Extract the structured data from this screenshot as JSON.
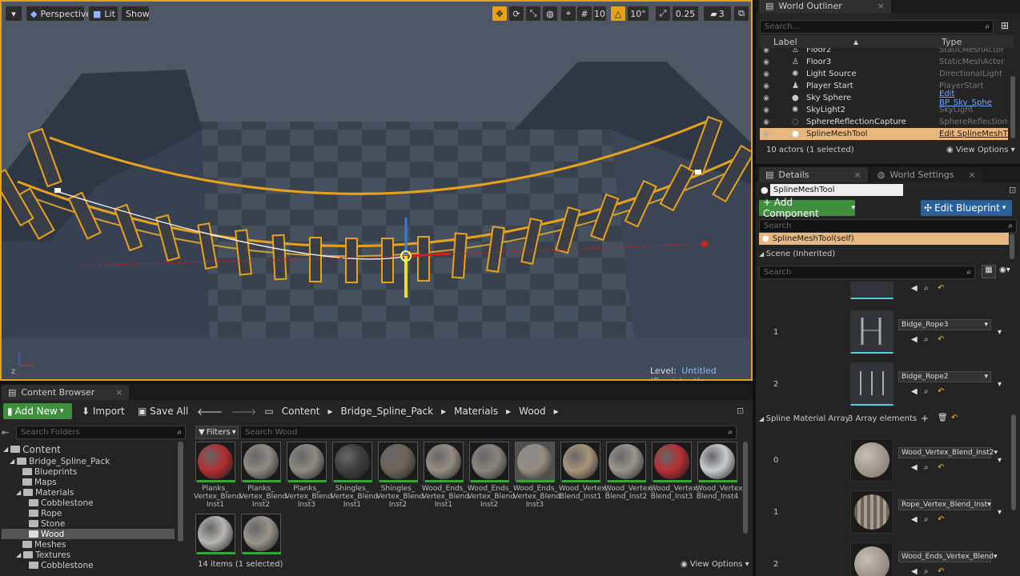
{
  "viewport": {
    "perspective_label": "Perspective",
    "lit_label": "Lit",
    "show_label": "Show",
    "grid_snap": "10",
    "angle_snap": "10°",
    "scale_snap": "0.25",
    "camera_speed": "3",
    "level_prefix": "Level:",
    "level_name": "Untitled (Persistent)",
    "accent": "#e8a21a"
  },
  "outliner": {
    "tab_title": "World Outliner",
    "search_placeholder": "Search...",
    "col_label": "Label",
    "col_type": "Type",
    "rows": [
      {
        "label": "Floor2",
        "type": "StaticMeshActor"
      },
      {
        "label": "Floor3",
        "type": "StaticMeshActor"
      },
      {
        "label": "Light Source",
        "type": "DirectionalLight"
      },
      {
        "label": "Player Start",
        "type": "PlayerStart"
      },
      {
        "label": "Sky Sphere",
        "type": "Edit BP_Sky_Sphe"
      },
      {
        "label": "SkyLight2",
        "type": "SkyLight"
      },
      {
        "label": "SphereReflectionCapture",
        "type": "SphereReflectionC"
      },
      {
        "label": "SplineMeshTool",
        "type": "Edit SplineMeshT"
      }
    ],
    "actor_count": "10 actors (1 selected)",
    "view_options": "View Options"
  },
  "details": {
    "tab_details": "Details",
    "tab_world_settings": "World Settings",
    "name_value": "SplineMeshTool",
    "add_component": "+ Add Component",
    "edit_blueprint": "Edit Blueprint",
    "search_placeholder": "Search",
    "self_item": "SplineMeshTool(self)",
    "scene_item": "Scene (Inherited)",
    "search2_placeholder": "Search",
    "mesh_rows": [
      {
        "index": "1",
        "name": "Bidge_Rope3"
      },
      {
        "index": "2",
        "name": "Bidge_Rope2"
      }
    ],
    "spline_material_label": "Spline Material Array",
    "spline_material_count": "3 Array elements",
    "material_rows": [
      {
        "index": "0",
        "name": "Wood_Vertex_Blend_Inst2"
      },
      {
        "index": "1",
        "name": "Rope_Vertex_Blend_Inst"
      },
      {
        "index": "2",
        "name": "Wood_Ends_Vertex_Blend"
      }
    ]
  },
  "content_browser": {
    "tab_title": "Content Browser",
    "add_new": "Add New",
    "import": "Import",
    "save_all": "Save All",
    "breadcrumb": [
      "Content",
      "Bridge_Spline_Pack",
      "Materials",
      "Wood"
    ],
    "search_folders_placeholder": "Search Folders",
    "filters_label": "Filters",
    "search_wood_placeholder": "Search Wood",
    "tree": [
      {
        "label": "Content",
        "level": 0
      },
      {
        "label": "Bridge_Spline_Pack",
        "level": 1
      },
      {
        "label": "Blueprints",
        "level": 2
      },
      {
        "label": "Maps",
        "level": 2
      },
      {
        "label": "Materials",
        "level": 2
      },
      {
        "label": "Cobblestone",
        "level": 3
      },
      {
        "label": "Rope",
        "level": 3
      },
      {
        "label": "Stone",
        "level": 3
      },
      {
        "label": "Wood",
        "level": 3
      },
      {
        "label": "Meshes",
        "level": 2
      },
      {
        "label": "Textures",
        "level": 2
      },
      {
        "label": "Cobblestone",
        "level": 3
      }
    ],
    "assets": [
      {
        "label": "Planks_ Vertex_Blend Inst1",
        "color": "#b13033"
      },
      {
        "label": "Planks_ Vertex_Blend Inst2",
        "color": "#8f8a82"
      },
      {
        "label": "Planks_ Vertex_Blend Inst3",
        "color": "#8e8a83"
      },
      {
        "label": "Shingles_ Vertex_Blend Inst1",
        "color": "#3c3f3c"
      },
      {
        "label": "Shingles_ Vertex_Blend Inst2",
        "color": "#6b6457"
      },
      {
        "label": "Wood_Ends_ Vertex_Blend Inst1",
        "color": "#948d82"
      },
      {
        "label": "Wood_Ends_ Vertex_Blend Inst2",
        "color": "#8a857c"
      },
      {
        "label": "Wood_Ends_ Vertex_Blend Inst3",
        "color": "#938c80"
      },
      {
        "label": "Wood_Vertex_ Blend_Inst1",
        "color": "#a8957a"
      },
      {
        "label": "Wood_Vertex_ Blend_Inst2",
        "color": "#9a948c"
      },
      {
        "label": "Wood_Vertex_ Blend_Inst3",
        "color": "#b53034"
      },
      {
        "label": "Wood_Vertex_ Blend_Inst4",
        "color": "#c8cbd0"
      },
      {
        "label": "",
        "color": "#b7b5b0"
      },
      {
        "label": "",
        "color": "#9a958b"
      }
    ],
    "item_count": "14 items (1 selected)",
    "view_options": "View Options"
  }
}
